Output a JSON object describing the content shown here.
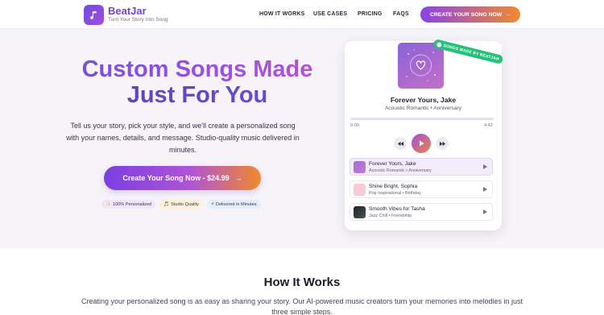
{
  "nav": {
    "brand": "BeatJar",
    "tagline": "Turn Your Story Into Song",
    "links": [
      "HOW IT WORKS",
      "USE CASES",
      "PRICING",
      "FAQS"
    ],
    "cta": "CREATE YOUR SONG NOW",
    "cta_arrow": "→"
  },
  "hero": {
    "title_line1": "Custom Songs Made",
    "title_line2": "Just For You",
    "description": "Tell us your story, pick your style, and we'll create a personalized song with your names, details, and message. Studio-quality music delivered in minutes.",
    "cta": "Create Your Song Now - $24.99",
    "cta_arrow": "→",
    "badges": [
      {
        "icon": "sparkle-icon",
        "glyph": "✨",
        "label": "100% Personalized"
      },
      {
        "icon": "music-note-icon",
        "glyph": "🎵",
        "label": "Studio Quality"
      },
      {
        "icon": "lightning-icon",
        "glyph": "⚡",
        "label": "Delivered in Minutes"
      }
    ]
  },
  "player": {
    "ribbon": "SONGS MADE BY BEATJAR",
    "now_playing": {
      "title": "Forever Yours, Jake",
      "subtitle": "Acoustic Romantic • Anniversary",
      "time_start": "0:00",
      "time_end": "4:42"
    },
    "playlist": [
      {
        "title": "Forever Yours, Jake",
        "subtitle": "Acoustic Romantic • Anniversary",
        "active": true,
        "thumb_color": "#9b6fd6"
      },
      {
        "title": "Shine Bright, Sophia",
        "subtitle": "Pop Inspirational • Birthday",
        "active": false,
        "thumb_color": "#f6cbd6"
      },
      {
        "title": "Smooth Vibes for Tasha",
        "subtitle": "Jazz Chill • Friendship",
        "active": false,
        "thumb_color": "#2a2f33"
      }
    ]
  },
  "how_it_works": {
    "title": "How It Works",
    "description": "Creating your personalized song is as easy as sharing your story. Our AI-powered music creators turn your memories into melodies in just three simple steps."
  },
  "colors": {
    "brand_purple": "#6d45d8",
    "accent_orange": "#f08a2e",
    "ribbon_green": "#22c278"
  }
}
